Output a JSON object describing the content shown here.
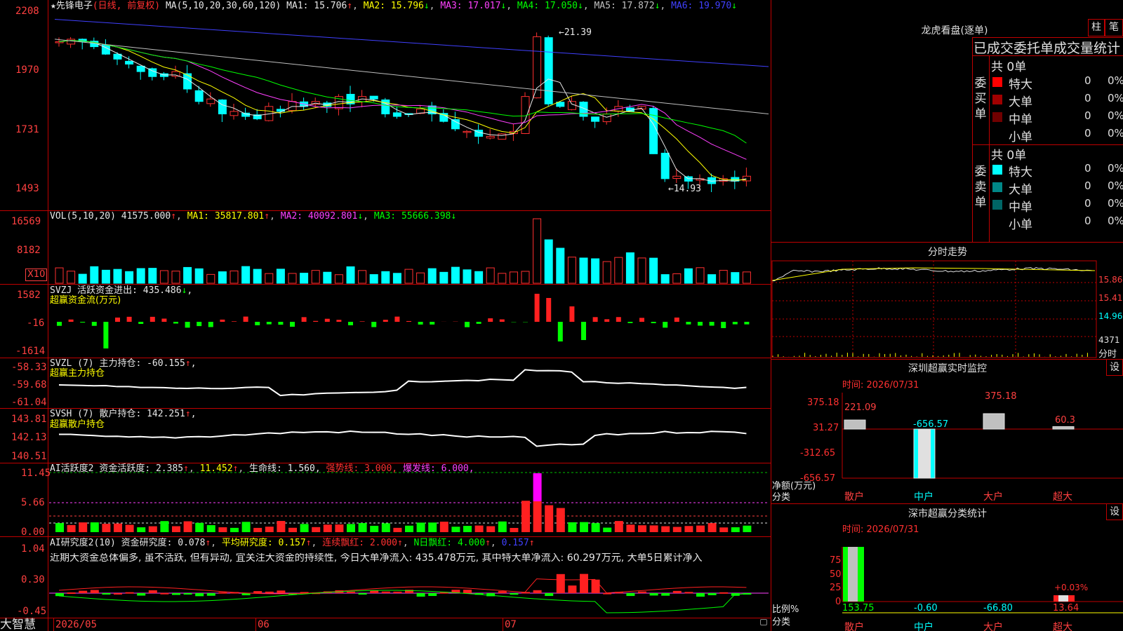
{
  "app": {
    "brand": "大智慧"
  },
  "stock": {
    "name_line": "★先锋电子",
    "period": "(日线, 前复权)",
    "ma_params": "MA(5,10,20,30,60,120)",
    "ma": [
      {
        "label": "MA1: 15.706",
        "dir": "↑",
        "color": "#e8e8e8"
      },
      {
        "label": "MA2: 15.796",
        "dir": "↓",
        "color": "#ffff00"
      },
      {
        "label": "MA3: 17.017",
        "dir": "↓",
        "color": "#ff40ff"
      },
      {
        "label": "MA4: 17.050",
        "dir": "↓",
        "color": "#00ff00"
      },
      {
        "label": "MA5: 17.872",
        "dir": "↓",
        "color": "#c0c0c0"
      },
      {
        "label": "MA6: 19.970",
        "dir": "↓",
        "color": "#4040ff"
      }
    ],
    "price_axis": [
      "2208",
      "1970",
      "1731",
      "1493"
    ],
    "high_mark": "21.39",
    "low_mark": "14.93"
  },
  "vol_panel": {
    "title": "VOL(5,10,20)",
    "value": "41575.000",
    "ma1": "MA1: 35817.801",
    "ma2": "MA2: 40092.801",
    "ma3": "MA3: 55666.398",
    "axis": [
      "16569",
      "8182"
    ],
    "unit": "X10"
  },
  "svzj": {
    "line1": "SVZJ  活跃资金进出: 435.486",
    "line2": "超赢资金流(万元)",
    "axis": [
      "1582",
      "-16",
      "-1614"
    ]
  },
  "svzl": {
    "line1": "SVZL (7) 主力持仓: -60.155",
    "line2": "超赢主力持仓",
    "axis": [
      "-58.33",
      "-59.68",
      "-61.04"
    ]
  },
  "svsh": {
    "line1": "SVSH (7) 散户持仓: 142.251",
    "line2": "超赢散户持仓",
    "axis": [
      "143.81",
      "142.13",
      "140.51"
    ]
  },
  "ai_active": {
    "title": "AI活跃度2",
    "p1": "资金活跃度: 2.385",
    "p2": "11.452",
    "p3": "生命线: 1.560,",
    "p4": "强势线: 3.000,",
    "p5": "爆发线: 6.000,",
    "axis": [
      "11.45",
      "5.66",
      "0.00"
    ]
  },
  "ai_research": {
    "title": "AI研究度2(10)",
    "p1": "资金研究度: 0.078",
    "p2": "平均研究度: 0.157",
    "p3": "连续飘红: 2.000",
    "p4": "N日飘红: 4.000",
    "p5": "0.157",
    "note": "近期大资金总体偏多, 虽不活跃, 但有异动, 宜关注大资金的持续性, 今日大单净流入: 435.478万元, 其中特大单净流入: 60.297万元, 大单5日累计净入",
    "axis": [
      "1.04",
      "0.30",
      "-0.45"
    ]
  },
  "time_axis": [
    "2026/05",
    "06",
    "07"
  ],
  "dragon": {
    "title": "龙虎看盘(逐单)",
    "btn1": "柱",
    "btn2": "笔",
    "header": "已成交委托单成交量统计",
    "buy_label": "委买单",
    "sell_label": "委卖单",
    "buy_total": "共 0单",
    "sell_total": "共 0单",
    "buy_rows": [
      {
        "name": "特大",
        "qty": "0",
        "pct": "0%",
        "color": "#ff0000"
      },
      {
        "name": "大单",
        "qty": "0",
        "pct": "0%",
        "color": "#a00000"
      },
      {
        "name": "中单",
        "qty": "0",
        "pct": "0%",
        "color": "#700000"
      },
      {
        "name": "小单",
        "qty": "0",
        "pct": "0%",
        "color": "#000000"
      }
    ],
    "sell_rows": [
      {
        "name": "特大",
        "qty": "0",
        "pct": "0%",
        "color": "#00ffff"
      },
      {
        "name": "大单",
        "qty": "0",
        "pct": "0%",
        "color": "#008888"
      },
      {
        "name": "中单",
        "qty": "0",
        "pct": "0%",
        "color": "#006666"
      },
      {
        "name": "小单",
        "qty": "0",
        "pct": "0%",
        "color": "#000000"
      }
    ]
  },
  "intraday": {
    "title": "分时走势",
    "axis": [
      "15.86",
      "15.41",
      "14.96",
      "4371"
    ],
    "sub": "分时"
  },
  "sz_monitor": {
    "title": "深圳超赢实时监控",
    "set": "设",
    "time": "时间: 2026/07/31",
    "axis": [
      "375.18",
      "31.27",
      "-312.65",
      "-656.57"
    ],
    "ylabel1": "净额(万元)",
    "ylabel2": "分类",
    "cats": [
      "散户",
      "中户",
      "大户",
      "超大"
    ],
    "values": [
      "221.09",
      "-656.57",
      "375.18",
      "60.3"
    ]
  },
  "sz_class": {
    "title": "深市超赢分类统计",
    "set": "设",
    "time": "时间: 2026/07/31",
    "axis": [
      "75",
      "50",
      "25",
      "0"
    ],
    "ylabel1": "比例%",
    "ylabel2": "分类",
    "cats": [
      "散户",
      "中户",
      "大户",
      "超大"
    ],
    "values": [
      "153.75",
      "-0.60",
      "-66.80",
      "13.64"
    ],
    "annotation": "+0.03%"
  }
}
